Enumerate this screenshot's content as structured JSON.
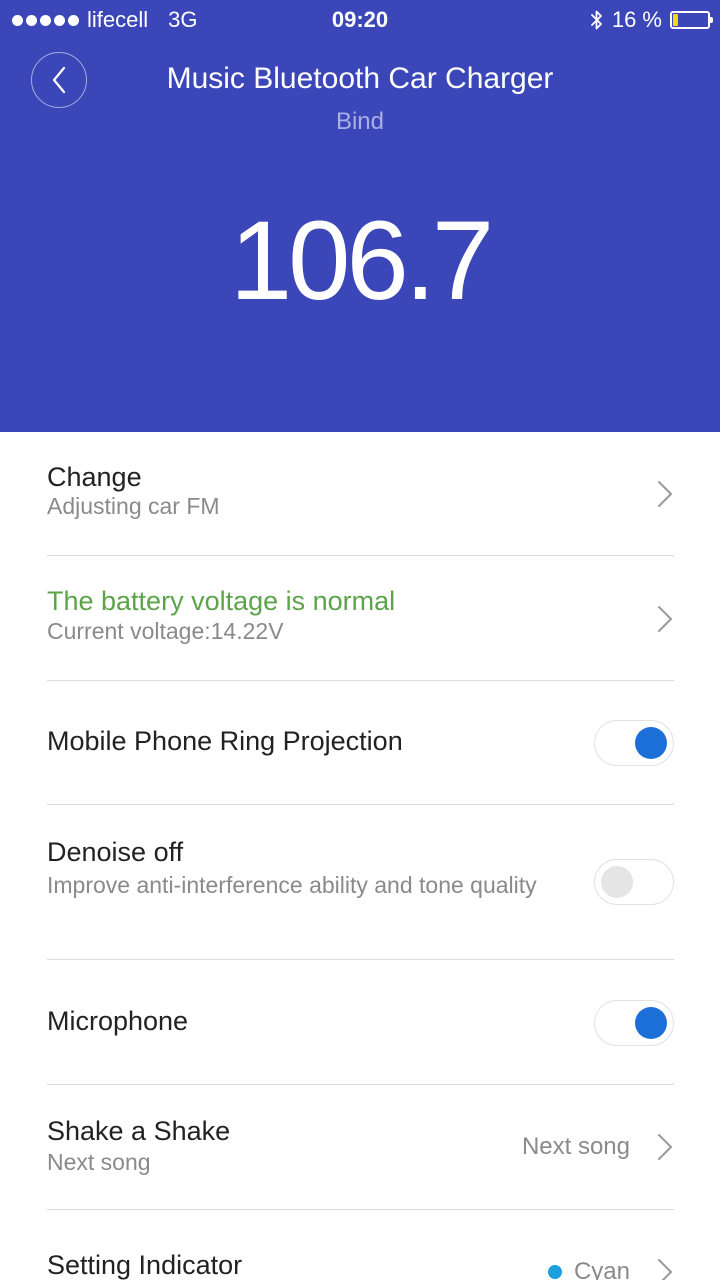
{
  "status_bar": {
    "carrier": "lifecell",
    "network": "3G",
    "time": "09:20",
    "battery_text": "16 %",
    "battery_level": 0.16,
    "icons": [
      "signal-dots-icon",
      "bluetooth-icon",
      "battery-icon"
    ]
  },
  "header": {
    "title": "Music Bluetooth Car Charger",
    "subtitle": "Bind",
    "frequency": "106.7",
    "background_color": "#3b47b8"
  },
  "settings": {
    "change": {
      "title": "Change",
      "subtitle": "Adjusting car FM"
    },
    "battery": {
      "title": "The battery voltage is normal",
      "subtitle": "Current voltage:14.22V",
      "title_color": "#5da34a"
    },
    "ring_projection": {
      "title": "Mobile Phone Ring Projection",
      "enabled": true
    },
    "denoise": {
      "title": "Denoise off",
      "subtitle": "Improve anti-interference ability and tone quality",
      "enabled": false
    },
    "microphone": {
      "title": "Microphone",
      "enabled": true
    },
    "shake": {
      "title": "Shake a Shake",
      "subtitle": "Next song",
      "value": "Next song"
    },
    "indicator": {
      "title": "Setting Indicator",
      "value": "Cyan",
      "dot_color": "#1a9fdf"
    }
  },
  "colors": {
    "toggle_on": "#1b6fd6",
    "toggle_off": "#e5e5e5"
  }
}
